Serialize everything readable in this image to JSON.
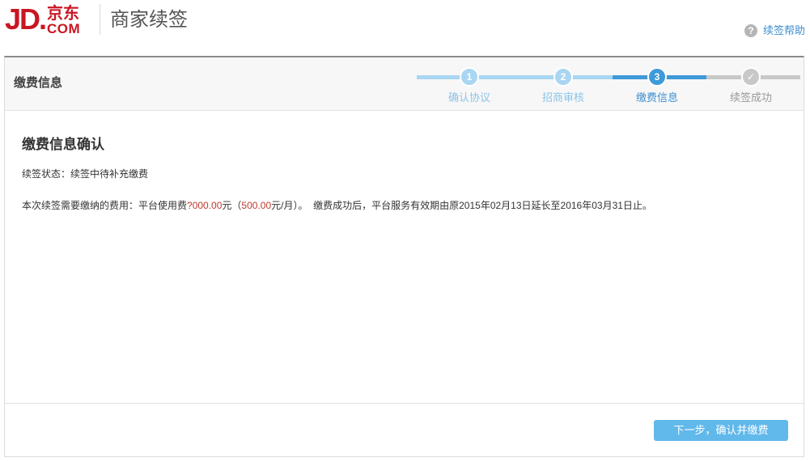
{
  "header": {
    "logo_jd": "JD.",
    "logo_cn": "京东",
    "logo_com": "COM",
    "app_title": "商家续签",
    "help_label": "续签帮助",
    "help_icon_glyph": "?"
  },
  "panel": {
    "title": "缴费信息"
  },
  "steps": [
    {
      "number": "1",
      "label": "确认协议",
      "state": "done"
    },
    {
      "number": "2",
      "label": "招商审核",
      "state": "done"
    },
    {
      "number": "3",
      "label": "缴费信息",
      "state": "current"
    },
    {
      "number": "✓",
      "label": "续签成功",
      "state": "pending"
    }
  ],
  "colors": {
    "done": "#a9d6f2",
    "current": "#3f9ad8",
    "pending": "#c8c8c8",
    "brand_red": "#c91623",
    "button": "#61b8ea"
  },
  "content": {
    "section_title": "缴费信息确认",
    "status_label": "续签状态：",
    "status_value": "续签中待补充缴费",
    "fee_prefix": "本次续签需要缴纳的费用：平台使用费",
    "fee_amount": "?000.00",
    "fee_unit": "元（",
    "fee_monthly": "500.00",
    "fee_monthly_unit": "元/月）。",
    "fee_after": "  缴费成功后，平台服务有效期由原2015年02月13日延长至2016年03月31日止。"
  },
  "footer": {
    "next_button": "下一步，确认并缴费"
  }
}
